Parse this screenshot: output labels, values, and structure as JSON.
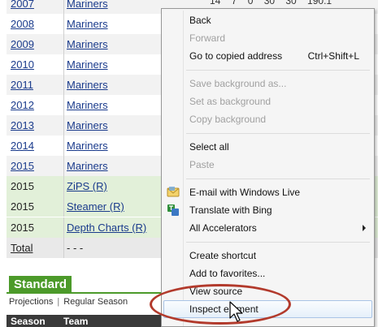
{
  "table": {
    "rows": [
      {
        "season": "2007",
        "team": "Mariners",
        "type": "alt",
        "values": "14 7 0 30 30 190.1"
      },
      {
        "season": "2008",
        "team": "Mariners",
        "type": "plain"
      },
      {
        "season": "2009",
        "team": "Mariners",
        "type": "alt"
      },
      {
        "season": "2010",
        "team": "Mariners",
        "type": "plain"
      },
      {
        "season": "2011",
        "team": "Mariners",
        "type": "alt"
      },
      {
        "season": "2012",
        "team": "Mariners",
        "type": "plain"
      },
      {
        "season": "2013",
        "team": "Mariners",
        "type": "alt"
      },
      {
        "season": "2014",
        "team": "Mariners",
        "type": "plain"
      },
      {
        "season": "2015",
        "team": "Mariners",
        "type": "alt"
      },
      {
        "season": "2015",
        "team": "ZiPS (R)",
        "type": "proj"
      },
      {
        "season": "2015",
        "team": "Steamer (R)",
        "type": "proj"
      },
      {
        "season": "2015",
        "team": "Depth Charts (R)",
        "type": "proj"
      },
      {
        "season": "Total",
        "team": "- - -",
        "type": "total"
      }
    ]
  },
  "section": {
    "title": "Standard",
    "subnav": {
      "projections": "Projections",
      "separator": "|",
      "regular_season": "Regular Season"
    },
    "headers": {
      "season": "Season",
      "team": "Team"
    }
  },
  "context_menu": {
    "items": [
      {
        "label": "Back",
        "enabled": true
      },
      {
        "label": "Forward",
        "enabled": false
      },
      {
        "label": "Go to copied address",
        "shortcut": "Ctrl+Shift+L",
        "enabled": true
      },
      {
        "label": "Save background as...",
        "enabled": false
      },
      {
        "label": "Set as background",
        "enabled": false
      },
      {
        "label": "Copy background",
        "enabled": false
      },
      {
        "label": "Select all",
        "enabled": true
      },
      {
        "label": "Paste",
        "enabled": false
      },
      {
        "label": "E-mail with Windows Live",
        "enabled": true,
        "icon": "windows-live-mail-icon"
      },
      {
        "label": "Translate with Bing",
        "enabled": true,
        "icon": "bing-translate-icon"
      },
      {
        "label": "All Accelerators",
        "enabled": true,
        "submenu": true
      },
      {
        "label": "Create shortcut",
        "enabled": true
      },
      {
        "label": "Add to favorites...",
        "enabled": true
      },
      {
        "label": "View source",
        "enabled": true
      },
      {
        "label": "Inspect element",
        "enabled": true,
        "highlighted": true
      }
    ]
  },
  "colors": {
    "link": "#1a3b8c",
    "projection_row": "#e2f0d9",
    "section_green": "#4c9a2a",
    "highlight_oval": "#b23a2c"
  }
}
